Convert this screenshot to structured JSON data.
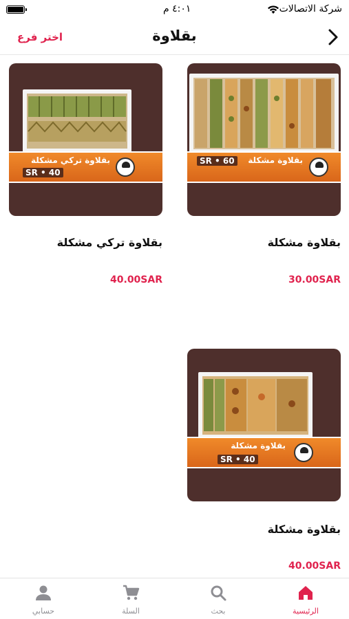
{
  "status": {
    "carrier": "شركة الاتصالات",
    "time": "٤:٠١ م"
  },
  "header": {
    "title": "بقلاوة",
    "branch_label": "اختر فرع",
    "back_icon": "chevron-right-icon"
  },
  "products": [
    {
      "name": "بقلاوة مشكلة",
      "price": "30.00SAR",
      "image_label": "بقلاوة مشكلة",
      "image_price": "SR • 60"
    },
    {
      "name": "بقلاوة تركي مشكلة",
      "price": "40.00SAR",
      "image_label": "بقلاوة تركي مشكلة",
      "image_price": "SR • 40"
    },
    {
      "name": "بقلاوة مشكلة",
      "price": "40.00SAR",
      "image_label": "بقلاوة مشكلة",
      "image_price": "SR • 40"
    }
  ],
  "tabs": [
    {
      "label": "الرئيسية",
      "icon": "home-icon",
      "active": true
    },
    {
      "label": "بحث",
      "icon": "search-icon",
      "active": false
    },
    {
      "label": "السلة",
      "icon": "cart-icon",
      "active": false
    },
    {
      "label": "حسابي",
      "icon": "person-icon",
      "active": false
    }
  ],
  "colors": {
    "accent": "#e0234e",
    "card_background": "#4e2f2c",
    "inactive_tab": "#8e8e93"
  }
}
